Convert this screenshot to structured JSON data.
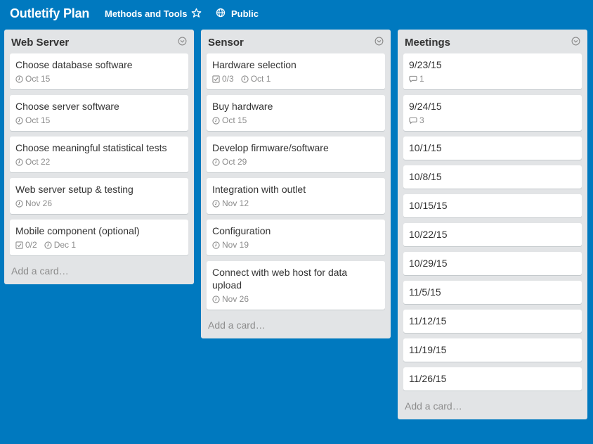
{
  "header": {
    "board_title": "Outletify Plan",
    "org_link": "Methods and Tools",
    "star_icon": "star-icon",
    "visibility_icon": "globe-icon",
    "visibility_label": "Public"
  },
  "colors": {
    "background": "#0079bf",
    "list_background": "#e2e4e6",
    "card_background": "#ffffff",
    "badge_text": "#8c8c8c"
  },
  "lists": [
    {
      "title": "Web Server",
      "add_card_label": "Add a card…",
      "cards": [
        {
          "title": "Choose database software",
          "due": "Oct 15"
        },
        {
          "title": "Choose server software",
          "due": "Oct 15"
        },
        {
          "title": "Choose meaningful statistical tests",
          "due": "Oct 22"
        },
        {
          "title": "Web server setup & testing",
          "due": "Nov 26"
        },
        {
          "title": "Mobile component (optional)",
          "checklist": "0/2",
          "due": "Dec 1"
        }
      ]
    },
    {
      "title": "Sensor",
      "add_card_label": "Add a card…",
      "cards": [
        {
          "title": "Hardware selection",
          "checklist": "0/3",
          "due": "Oct 1"
        },
        {
          "title": "Buy hardware",
          "due": "Oct 15"
        },
        {
          "title": "Develop firmware/software",
          "due": "Oct 29"
        },
        {
          "title": "Integration with outlet",
          "due": "Nov 12"
        },
        {
          "title": "Configuration",
          "due": "Nov 19"
        },
        {
          "title": "Connect with web host for data upload",
          "due": "Nov 26"
        }
      ]
    },
    {
      "title": "Meetings",
      "add_card_label": "Add a card…",
      "cards": [
        {
          "title": "9/23/15",
          "comments": "1"
        },
        {
          "title": "9/24/15",
          "comments": "3"
        },
        {
          "title": "10/1/15"
        },
        {
          "title": "10/8/15"
        },
        {
          "title": "10/15/15"
        },
        {
          "title": "10/22/15"
        },
        {
          "title": "10/29/15"
        },
        {
          "title": "11/5/15"
        },
        {
          "title": "11/12/15"
        },
        {
          "title": "11/19/15"
        },
        {
          "title": "11/26/15"
        }
      ]
    }
  ]
}
